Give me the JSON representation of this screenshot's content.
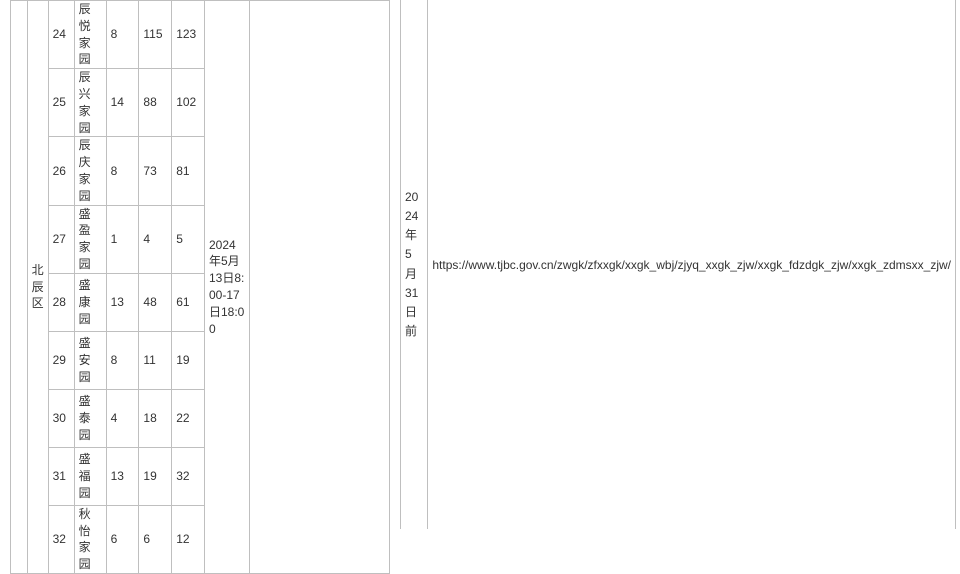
{
  "district": "北辰区",
  "time_window": "2024年5月13日8:00-17日18:00",
  "publish_deadline": "2024年5月31日前",
  "url": "https://www.tjbc.gov.cn/zwgk/zfxxgk/xxgk_wbj/zjyq_xxgk_zjw/xxgk_fdzdgk_zjw/xxgk_zdmsxx_zjw/",
  "rows": [
    {
      "idx": "24",
      "name": "辰悦家园",
      "a": "8",
      "b": "115",
      "c": "123"
    },
    {
      "idx": "25",
      "name": "辰兴家园",
      "a": "14",
      "b": "88",
      "c": "102"
    },
    {
      "idx": "26",
      "name": "辰庆家园",
      "a": "8",
      "b": "73",
      "c": "81"
    },
    {
      "idx": "27",
      "name": "盛盈家园",
      "a": "1",
      "b": "4",
      "c": "5"
    },
    {
      "idx": "28",
      "name": "盛康园",
      "a": "13",
      "b": "48",
      "c": "61"
    },
    {
      "idx": "29",
      "name": "盛安园",
      "a": "8",
      "b": "11",
      "c": "19"
    },
    {
      "idx": "30",
      "name": "盛泰园",
      "a": "4",
      "b": "18",
      "c": "22"
    },
    {
      "idx": "31",
      "name": "盛福园",
      "a": "13",
      "b": "19",
      "c": "32"
    },
    {
      "idx": "32",
      "name": "秋怡家园",
      "a": "6",
      "b": "6",
      "c": "12"
    }
  ]
}
